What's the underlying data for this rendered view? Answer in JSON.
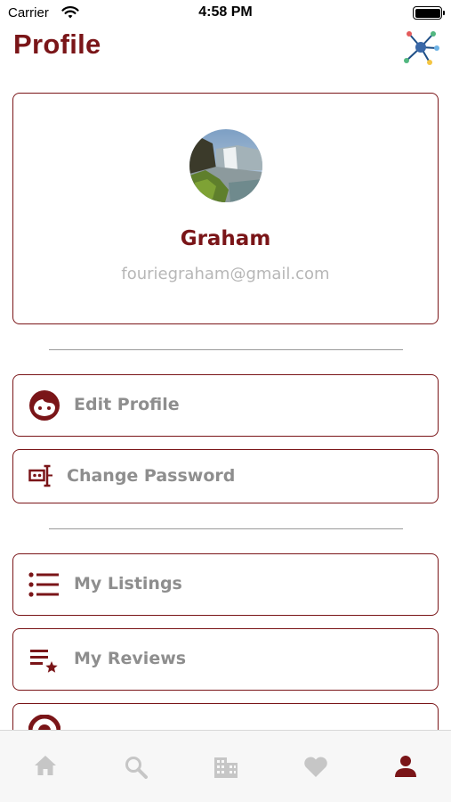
{
  "status_bar": {
    "carrier": "Carrier",
    "time": "4:58 PM"
  },
  "header": {
    "title": "Profile",
    "action_icon": "network-nodes-icon"
  },
  "profile": {
    "name": "Graham",
    "email": "fouriegraham@gmail.com",
    "avatar": "waterfall-landscape-photo"
  },
  "menu": {
    "edit_profile": "Edit Profile",
    "change_password": "Change Password",
    "my_listings": "My Listings",
    "my_reviews": "My Reviews"
  },
  "tab_bar": {
    "items": [
      "home-icon",
      "search-icon",
      "building-icon",
      "heart-icon",
      "person-icon"
    ],
    "active": "person-icon"
  },
  "colors": {
    "accent": "#7a1518",
    "label_gray": "#8e8e8e",
    "email_gray": "#b7b7b7",
    "tab_inactive": "#c6c6c6"
  }
}
